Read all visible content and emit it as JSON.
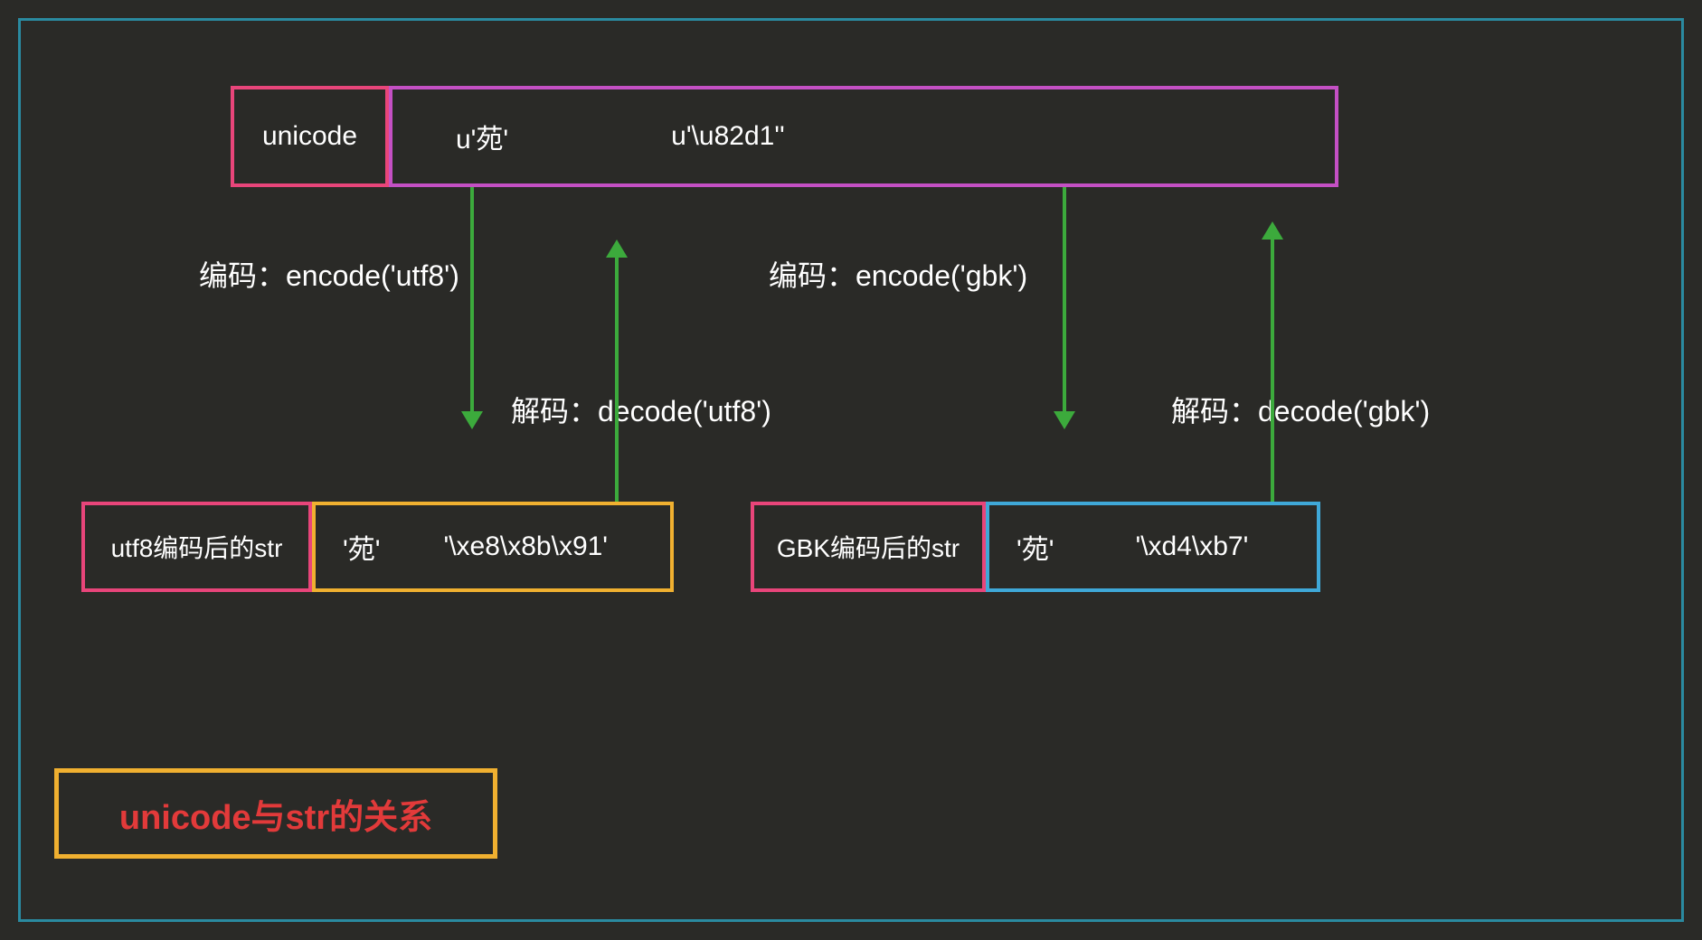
{
  "unicode": {
    "label": "unicode",
    "value1": "u'苑'",
    "value2": "u'\\u82d1''"
  },
  "encode": {
    "utf8_label": "编码：encode('utf8')",
    "gbk_label": "编码：encode('gbk')"
  },
  "decode": {
    "utf8_label": "解码：decode('utf8')",
    "gbk_label": "解码：decode('gbk')"
  },
  "utf8": {
    "label": "utf8编码后的str",
    "value1": "'苑'",
    "value2": "'\\xe8\\x8b\\x91'"
  },
  "gbk": {
    "label": "GBK编码后的str",
    "value1": "'苑'",
    "value2": "'\\xd4\\xb7'"
  },
  "title": "unicode与str的关系"
}
